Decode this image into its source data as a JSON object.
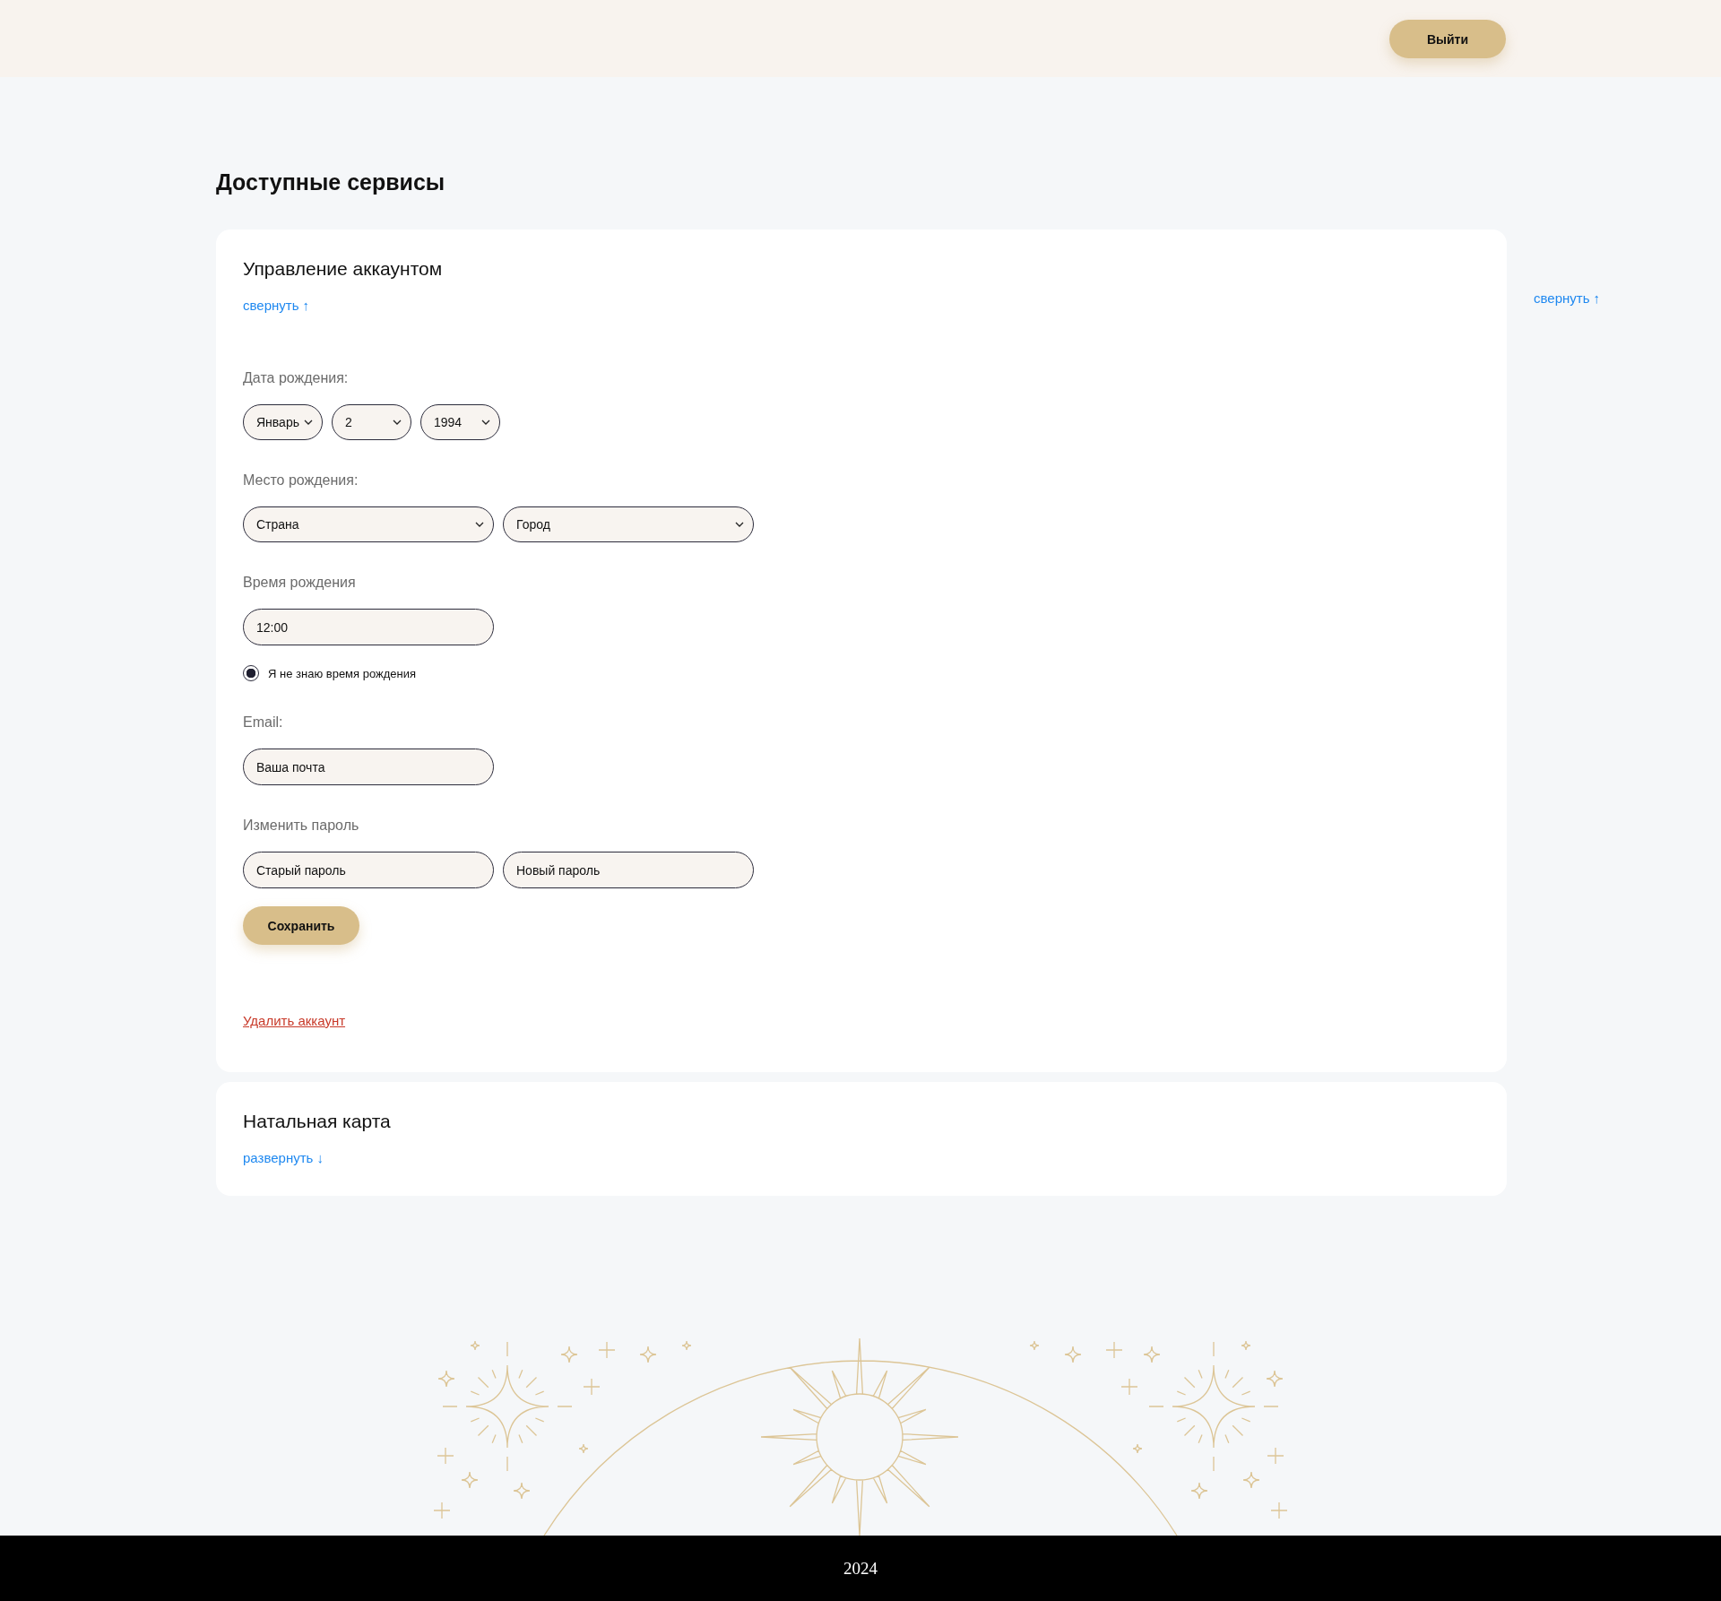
{
  "header": {
    "logout_button": "Выйти"
  },
  "page_title": "Доступные сервисы",
  "side_toggle": "свернуть ↑",
  "services": [
    {
      "title": "Управление аккаунтом",
      "toggle": "свернуть ↑",
      "expanded": true,
      "form": [
        {
          "kind": "short_selects",
          "label": "Дата рождения:",
          "values": [
            "Январь",
            "2",
            "1994"
          ]
        },
        {
          "kind": "selects",
          "label": "Место рождения:",
          "values": [
            "Страна",
            "Город"
          ]
        },
        {
          "kind": "inputs",
          "label": "Время рождения",
          "fields": [
            {
              "value": "12:00"
            }
          ]
        },
        {
          "kind": "radio",
          "text": "Я не знаю время рождения",
          "checked": true
        },
        {
          "kind": "inputs",
          "label": "Email:",
          "fields": [
            {
              "placeholder": "Ваша почта"
            }
          ]
        },
        {
          "kind": "inputs",
          "label": "Изменить пароль",
          "fields": [
            {
              "placeholder": "Старый пароль"
            },
            {
              "placeholder": "Новый пароль"
            }
          ]
        },
        {
          "kind": "button",
          "text": "Сохранить"
        },
        {
          "kind": "danger_link",
          "text": "Удалить аккаунт"
        }
      ]
    },
    {
      "title": "Натальная карта",
      "toggle": "развернуть ↓",
      "expanded": false
    }
  ],
  "footer": {
    "year": "2024"
  }
}
